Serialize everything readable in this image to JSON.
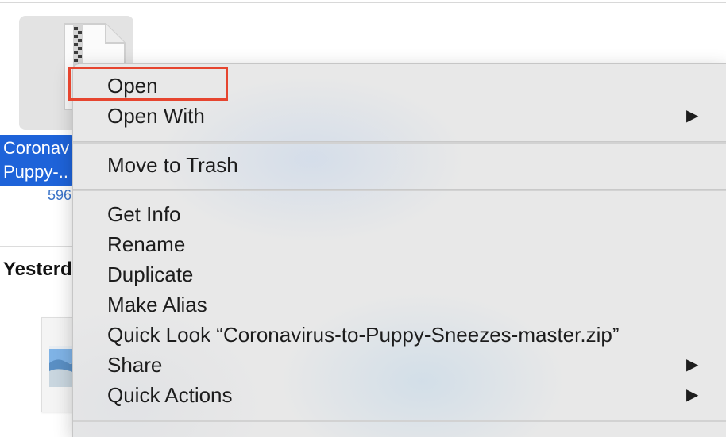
{
  "file": {
    "name_line1": "Coronav",
    "name_line2": "Puppy-..",
    "size": "596"
  },
  "sections": {
    "yesterday": "Yesterd"
  },
  "menu": {
    "items": [
      {
        "label": "Open"
      },
      {
        "label": "Open With",
        "submenu": "▶"
      },
      {
        "label": "Move to Trash"
      },
      {
        "label": "Get Info"
      },
      {
        "label": "Rename"
      },
      {
        "label": "Duplicate"
      },
      {
        "label": "Make Alias"
      },
      {
        "label": "Quick Look “Coronavirus-to-Puppy-Sneezes-master.zip”"
      },
      {
        "label": "Share",
        "submenu": "▶"
      },
      {
        "label": "Quick Actions",
        "submenu": "▶"
      }
    ]
  },
  "colors": {
    "selection": "#1e63d9",
    "highlight_outline": "#e6452f",
    "menu_background": "#e8e8e8"
  },
  "icons": {
    "zip": "zip-archive-icon",
    "image": "image-file-icon",
    "submenu": "submenu-arrow-icon"
  }
}
